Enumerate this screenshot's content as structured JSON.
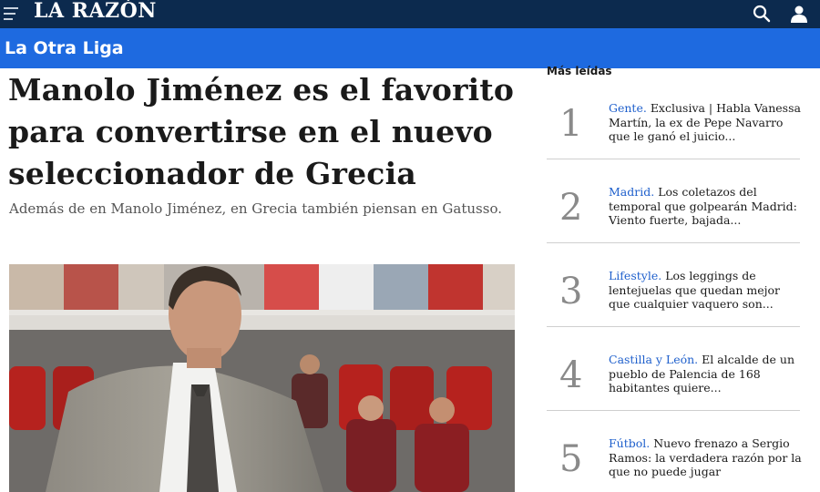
{
  "header": {
    "logo": "LA RAZÓN",
    "menu_icon": "hamburger-menu-icon",
    "search_icon": "search-icon",
    "user_icon": "user-icon"
  },
  "section": {
    "label": "La Otra Liga"
  },
  "article": {
    "headline": "Manolo Jiménez es el favorito para convertirse en el nuevo seleccionador de Grecia",
    "subtitle": "Además de en Manolo Jiménez, en Grecia también piensan en Gatusso."
  },
  "sidebar": {
    "title": "Más leídas",
    "items": [
      {
        "rank": "1",
        "category": "Gente.",
        "text": "Exclusiva | Habla Vanessa Martín, la ex de Pepe Navarro que le ganó el juicio..."
      },
      {
        "rank": "2",
        "category": "Madrid.",
        "text": "Los coletazos del temporal que golpearán Madrid: Viento fuerte, bajada..."
      },
      {
        "rank": "3",
        "category": "Lifestyle.",
        "text": "Los leggings de lentejuelas que quedan mejor que cualquier vaquero son..."
      },
      {
        "rank": "4",
        "category": "Castilla y León.",
        "text": "El alcalde de un pueblo de Palencia de 168 habitantes quiere..."
      },
      {
        "rank": "5",
        "category": "Fútbol.",
        "text": "Nuevo frenazo a Sergio Ramos: la verdadera razón por la que no puede jugar"
      }
    ]
  },
  "colors": {
    "topbar": "#0c2a4e",
    "section_bar": "#1e6ae0",
    "category_link": "#1e5fcc"
  }
}
